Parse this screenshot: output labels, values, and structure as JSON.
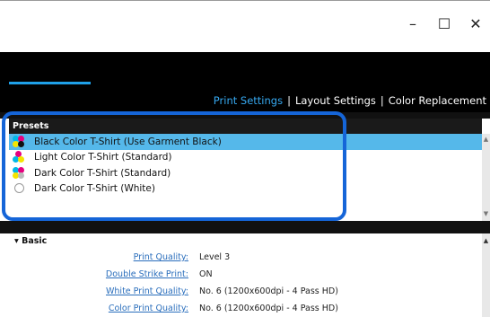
{
  "window": {
    "minimize": "–",
    "maximize": "☐",
    "close": "✕"
  },
  "tabs": [
    {
      "label": "Print Settings",
      "active": true
    },
    {
      "label": "Layout Settings",
      "active": false
    },
    {
      "label": "Color Replacement",
      "active": false
    }
  ],
  "tab_separator": "|",
  "presets": {
    "title": "Presets",
    "items": [
      {
        "label": "Black Color T-Shirt (Use Garment Black)",
        "icon": "cmyk-icon",
        "selected": true
      },
      {
        "label": "Light Color T-Shirt (Standard)",
        "icon": "cmy-icon",
        "selected": false
      },
      {
        "label": "Dark Color T-Shirt (Standard)",
        "icon": "cmyk-icon",
        "selected": false
      },
      {
        "label": "Dark Color T-Shirt (White)",
        "icon": "white-icon",
        "selected": false
      }
    ]
  },
  "basic": {
    "title": "Basic",
    "rows": [
      {
        "label": "Print Quality:",
        "value": "Level 3"
      },
      {
        "label": "Double Strike Print:",
        "value": "ON"
      },
      {
        "label": "White Print Quality:",
        "value": "No. 6 (1200x600dpi - 4 Pass HD)"
      },
      {
        "label": "Color Print Quality:",
        "value": "No. 6 (1200x600dpi - 4 Pass HD)"
      }
    ]
  },
  "colors": {
    "accent": "#1fa0e8",
    "selected_row": "#55b8ea",
    "highlight_border": "#1565d8",
    "link": "#2a6ebc"
  }
}
